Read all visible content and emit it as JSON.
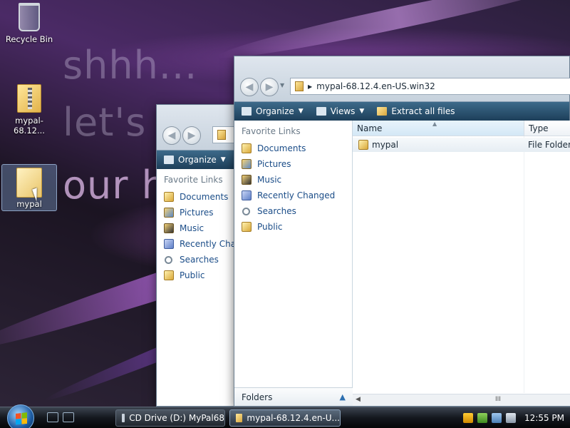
{
  "desktop": {
    "wallpaper_text": [
      "shhh...",
      "let's t",
      "our h"
    ],
    "icons": [
      {
        "label": "Recycle Bin",
        "icon": "recycle-bin-icon"
      },
      {
        "label": "mypal-68.12...",
        "icon": "zip-folder-icon"
      },
      {
        "label": "mypal",
        "icon": "folder-icon"
      }
    ]
  },
  "back_window": {
    "toolbar": {
      "organize": "Organize"
    },
    "nav": {
      "title": "Favorite Links",
      "items": [
        "Documents",
        "Pictures",
        "Music",
        "Recently Chan",
        "Searches",
        "Public"
      ]
    }
  },
  "front_window": {
    "address": "mypal-68.12.4.en-US.win32",
    "toolbar": {
      "organize": "Organize",
      "views": "Views",
      "extract": "Extract all files"
    },
    "nav": {
      "title": "Favorite Links",
      "items": [
        "Documents",
        "Pictures",
        "Music",
        "Recently Changed",
        "Searches",
        "Public"
      ],
      "folders_label": "Folders"
    },
    "columns": [
      "Name",
      "Type"
    ],
    "rows": [
      {
        "name": "mypal",
        "type": "File Folder"
      }
    ],
    "scroll_mark": "III"
  },
  "taskbar": {
    "buttons": [
      "CD Drive (D:) MyPal68",
      "mypal-68.12.4.en-U..."
    ],
    "clock": "12:55 PM"
  }
}
